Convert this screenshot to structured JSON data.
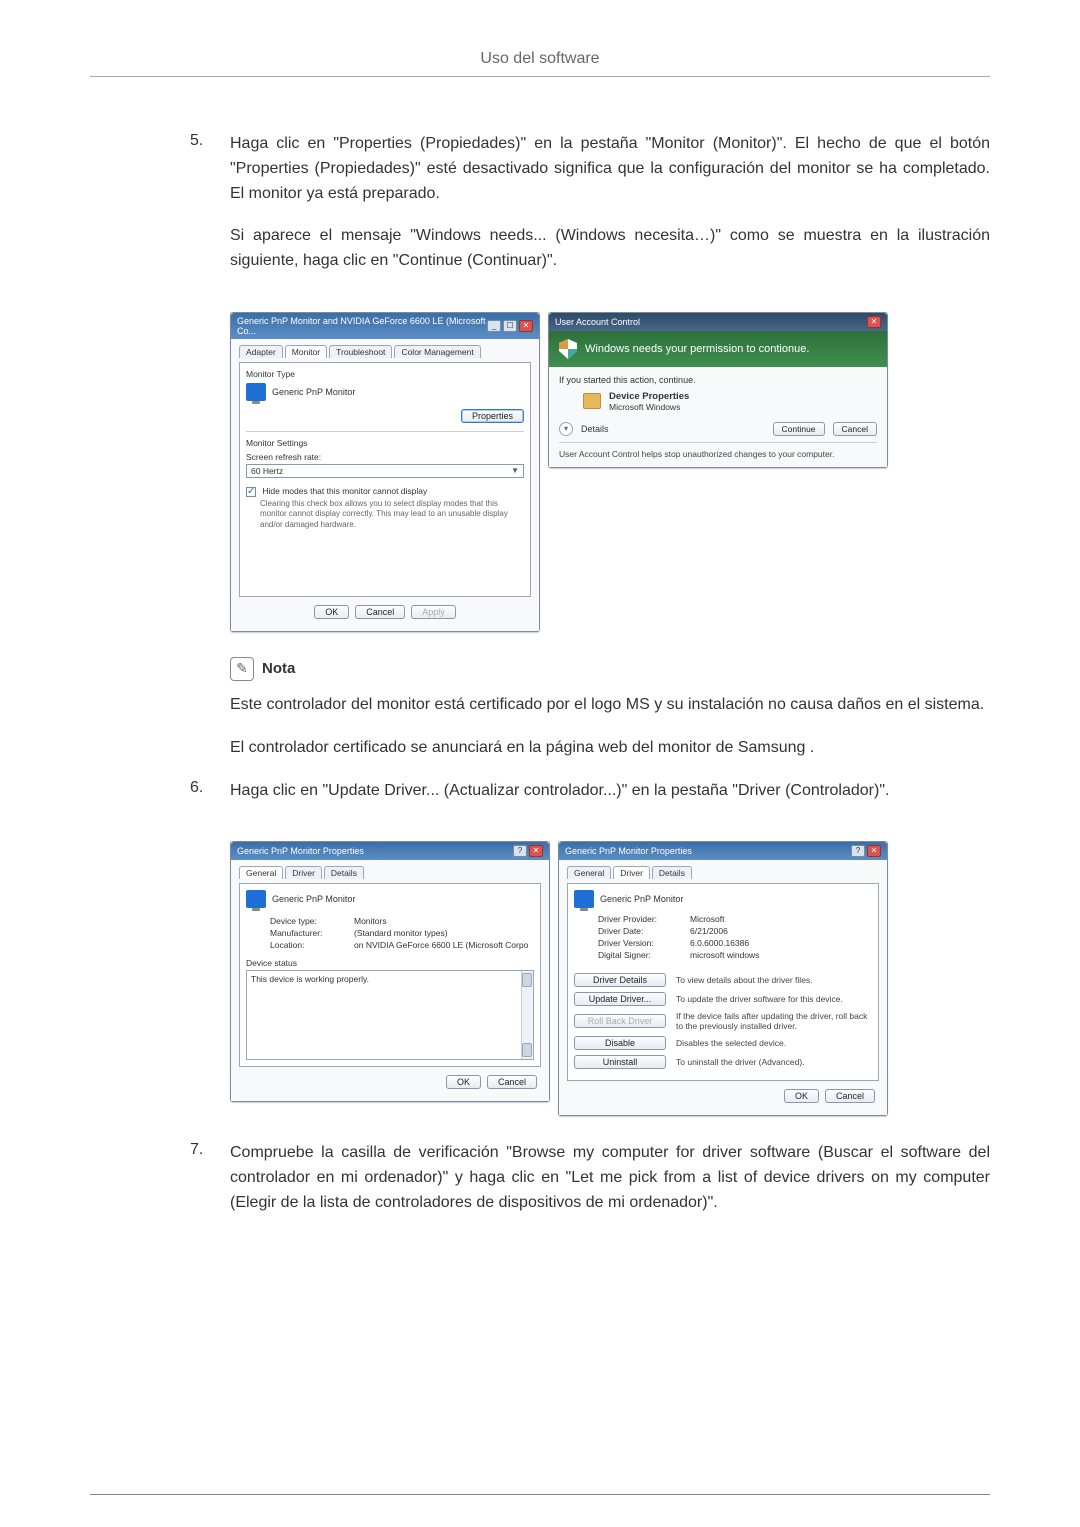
{
  "header": {
    "title": "Uso del software"
  },
  "steps": {
    "s5": {
      "num": "5.",
      "p1": "Haga clic en \"Properties (Propiedades)\" en la pestaña \"Monitor (Monitor)\". El hecho de que el botón \"Properties (Propiedades)\" esté desactivado significa que la configuración del monitor se ha completado. El monitor ya está preparado.",
      "p2": "Si aparece el mensaje \"Windows needs... (Windows necesita…)\" como se muestra en la ilustración siguiente, haga clic en \"Continue (Continuar)\"."
    },
    "s6": {
      "num": "6.",
      "p1": "Haga clic en \"Update Driver... (Actualizar controlador...)\" en la pestaña \"Driver (Controlador)\"."
    },
    "s7": {
      "num": "7.",
      "p1": "Compruebe la casilla de verificación \"Browse my computer for driver software (Buscar el software del controlador en mi ordenador)\" y haga clic en \"Let me pick from a list of device drivers on my computer (Elegir de la lista de controladores de dispositivos de mi ordenador)\"."
    }
  },
  "note": {
    "label": "Nota",
    "p1": "Este controlador del monitor está certificado por el logo MS y su instalación no causa daños en el sistema.",
    "p2": "El controlador certificado se anunciará en la página web del monitor de Samsung ."
  },
  "dlg_monitor": {
    "title": "Generic PnP Monitor and NVIDIA GeForce 6600 LE (Microsoft Co...",
    "tabs": {
      "adapter": "Adapter",
      "monitor": "Monitor",
      "troubleshoot": "Troubleshoot",
      "color": "Color Management"
    },
    "monitor_type_label": "Monitor Type",
    "monitor_name": "Generic PnP Monitor",
    "properties_btn": "Properties",
    "settings_label": "Monitor Settings",
    "refresh_label": "Screen refresh rate:",
    "refresh_value": "60 Hertz",
    "hide_modes": "Hide modes that this monitor cannot display",
    "hide_desc": "Clearing this check box allows you to select display modes that this monitor cannot display correctly. This may lead to an unusable display and/or damaged hardware.",
    "ok": "OK",
    "cancel": "Cancel",
    "apply": "Apply"
  },
  "dlg_uac": {
    "title": "User Account Control",
    "banner": "Windows needs your permission to contionue.",
    "started": "If you started this action, continue.",
    "prog_name": "Device Properties",
    "publisher": "Microsoft Windows",
    "details": "Details",
    "continue": "Continue",
    "cancel": "Cancel",
    "footer": "User Account Control helps stop unauthorized changes to your computer."
  },
  "dlg_props_general": {
    "title": "Generic PnP Monitor Properties",
    "tabs": {
      "general": "General",
      "driver": "Driver",
      "details": "Details"
    },
    "name": "Generic PnP Monitor",
    "dev_type_l": "Device type:",
    "dev_type_v": "Monitors",
    "manu_l": "Manufacturer:",
    "manu_v": "(Standard monitor types)",
    "loc_l": "Location:",
    "loc_v": "on NVIDIA GeForce 6600 LE (Microsoft Corpo",
    "status_l": "Device status",
    "status_v": "This device is working properly.",
    "ok": "OK",
    "cancel": "Cancel"
  },
  "dlg_props_driver": {
    "title": "Generic PnP Monitor Properties",
    "tabs": {
      "general": "General",
      "driver": "Driver",
      "details": "Details"
    },
    "name": "Generic PnP Monitor",
    "prov_l": "Driver Provider:",
    "prov_v": "Microsoft",
    "date_l": "Driver Date:",
    "date_v": "6/21/2006",
    "ver_l": "Driver Version:",
    "ver_v": "6.0.6000.16386",
    "sign_l": "Digital Signer:",
    "sign_v": "microsoft windows",
    "btn_details": "Driver Details",
    "desc_details": "To view details about the driver files.",
    "btn_update": "Update Driver...",
    "desc_update": "To update the driver software for this device.",
    "btn_rollback": "Roll Back Driver",
    "desc_rollback": "If the device fails after updating the driver, roll back to the previously installed driver.",
    "btn_disable": "Disable",
    "desc_disable": "Disables the selected device.",
    "btn_uninstall": "Uninstall",
    "desc_uninstall": "To uninstall the driver (Advanced).",
    "ok": "OK",
    "cancel": "Cancel"
  }
}
